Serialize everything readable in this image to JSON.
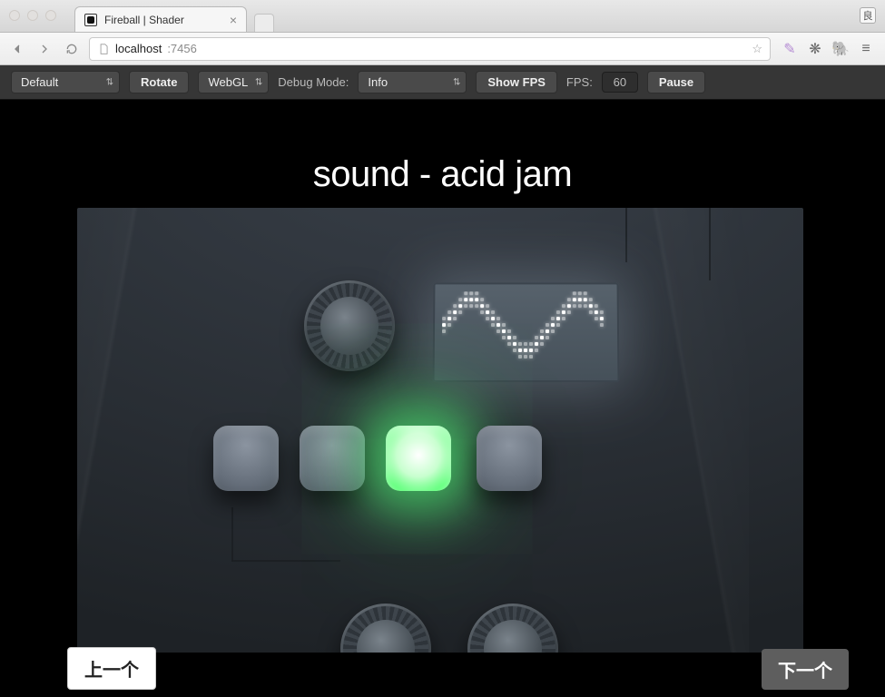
{
  "browser": {
    "tab_title": "Fireball | Shader",
    "corner_badge": "良",
    "url_host": "localhost",
    "url_port": ":7456"
  },
  "toolbar": {
    "scene_select": "Default",
    "rotate_label": "Rotate",
    "renderer_select": "WebGL",
    "debug_mode_label": "Debug Mode:",
    "debug_level_select": "Info",
    "show_fps_label": "Show FPS",
    "fps_label": "FPS:",
    "fps_value": "60",
    "pause_label": "Pause"
  },
  "scene": {
    "title": "sound - acid jam",
    "prev_label": "上一个",
    "next_label": "下一个"
  }
}
